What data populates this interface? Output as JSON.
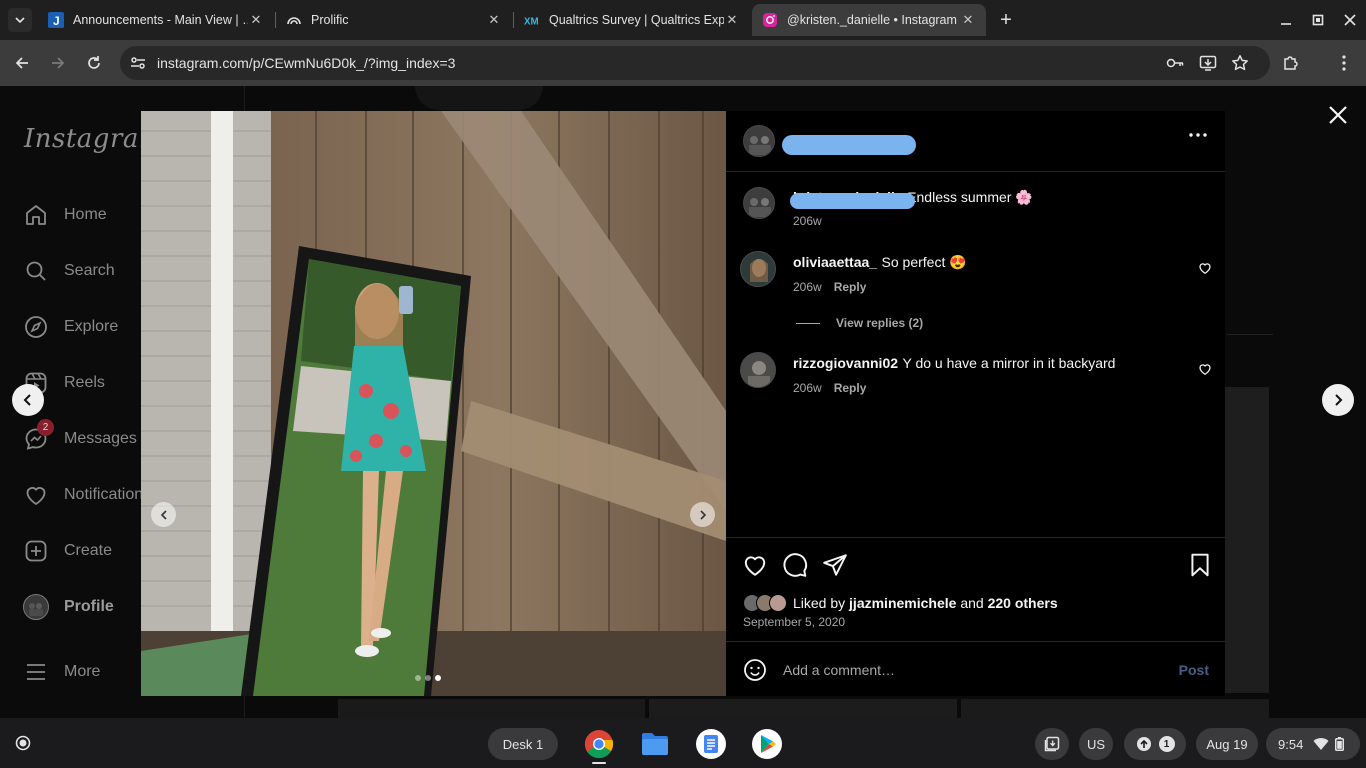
{
  "browser": {
    "tabs": [
      {
        "title": "Announcements - Main View | …",
        "favicon": "j-logo-icon",
        "active": false
      },
      {
        "title": "Prolific",
        "favicon": "prolific-icon",
        "active": false
      },
      {
        "title": "Qualtrics Survey | Qualtrics Exp",
        "favicon": "xm-icon",
        "active": false
      },
      {
        "title": "@kristen._danielle • Instagram",
        "favicon": "instagram-icon",
        "active": true
      }
    ],
    "url": "instagram.com/p/CEwmNu6D0k_/?img_index=3"
  },
  "sidebar": {
    "logo": "Instagram",
    "items": [
      {
        "label": "Home",
        "icon": "home-icon"
      },
      {
        "label": "Search",
        "icon": "search-icon"
      },
      {
        "label": "Explore",
        "icon": "compass-icon"
      },
      {
        "label": "Reels",
        "icon": "reels-icon"
      },
      {
        "label": "Messages",
        "icon": "messenger-icon",
        "badge": "2"
      },
      {
        "label": "Notifications",
        "icon": "heart-icon"
      },
      {
        "label": "Create",
        "icon": "plus-square-icon"
      },
      {
        "label": "Profile",
        "icon": "avatar"
      },
      {
        "label": "More",
        "icon": "menu-icon"
      }
    ]
  },
  "post": {
    "image_index": 3,
    "image_count": 3,
    "caption": {
      "username": "kristen._danielle",
      "text": "Endless summer 🌸",
      "time": "206w"
    },
    "comments": [
      {
        "username": "oliviaaettaa_",
        "text": "So perfect 😍",
        "time": "206w",
        "reply": "Reply",
        "view_replies": "View replies (2)"
      },
      {
        "username": "rizzogiovanni02",
        "text": "Y do u have a mirror in it backyard",
        "time": "206w",
        "reply": "Reply"
      }
    ],
    "liked_by_prefix": "Liked by",
    "liked_by_user": "jjazminemichele",
    "liked_by_and": "and",
    "liked_by_others": "220 others",
    "date": "September 5, 2020",
    "comment_placeholder": "Add a comment…",
    "post_button": "Post"
  },
  "shelf": {
    "desk": "Desk 1",
    "apps": [
      "chrome-icon",
      "files-icon",
      "docs-icon",
      "play-store-icon"
    ],
    "ime": "US",
    "notifications": "1",
    "date": "Aug 19",
    "time": "9:54"
  },
  "colors": {
    "redaction": "#7ab3ee",
    "link_blue": "#4a5d85",
    "badge_red": "#8a1f2c"
  }
}
